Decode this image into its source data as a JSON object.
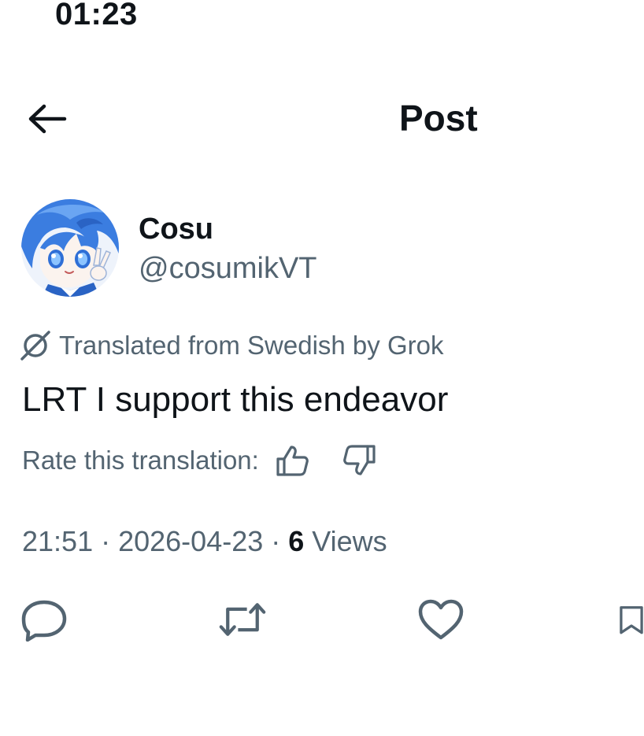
{
  "status_bar": {
    "time": "01:23"
  },
  "header": {
    "title": "Post",
    "back_icon": "arrow-left-icon"
  },
  "author": {
    "display_name": "Cosu",
    "handle": "@cosumikVT",
    "avatar": "avatar-anime-blue-hair"
  },
  "translation": {
    "label": "Translated from Swedish by Grok",
    "icon": "grok-icon"
  },
  "post": {
    "text": "LRT I support this endeavor"
  },
  "rate": {
    "label": "Rate this translation:",
    "thumbs_up_icon": "thumbs-up-icon",
    "thumbs_down_icon": "thumbs-down-icon"
  },
  "meta": {
    "time": "21:51",
    "sep1": " · ",
    "date": "2026-04-23",
    "sep2": " · ",
    "views_count": "6",
    "views_label": " Views"
  },
  "actions": [
    "reply-icon",
    "repost-icon",
    "like-icon",
    "bookmark-icon"
  ],
  "colors": {
    "text_primary": "#0f1419",
    "text_secondary": "#536471",
    "background": "#ffffff",
    "avatar_blue": "#3b7de0"
  }
}
